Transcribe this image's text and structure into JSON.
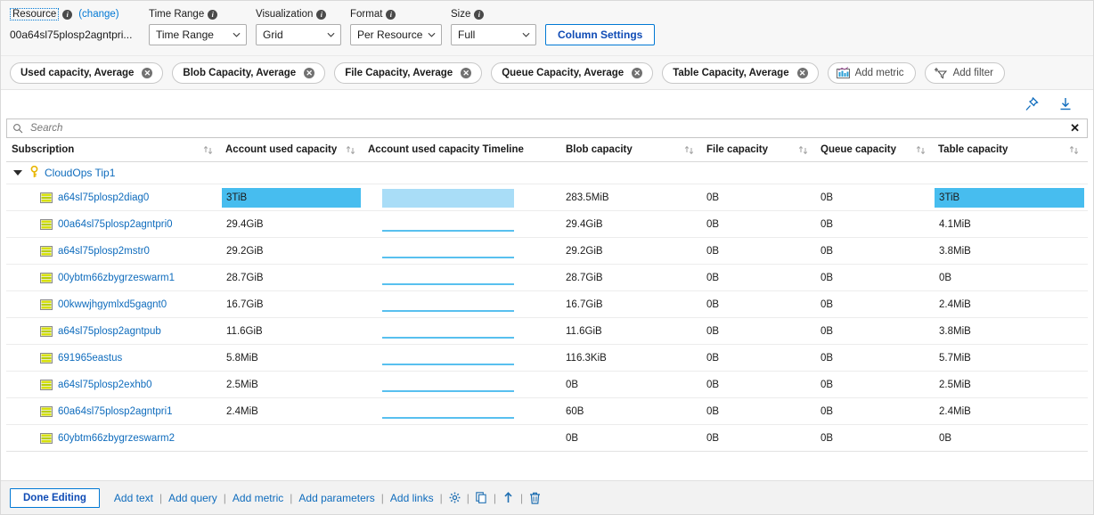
{
  "params": {
    "resource": {
      "label": "Resource",
      "change_link": "(change)",
      "value": "00a64sl75plosp2agntpri..."
    },
    "time_range": {
      "label": "Time Range",
      "value": "Time Range"
    },
    "visualization": {
      "label": "Visualization",
      "value": "Grid"
    },
    "format": {
      "label": "Format",
      "value": "Per Resource"
    },
    "size": {
      "label": "Size",
      "value": "Full"
    },
    "column_settings_label": "Column Settings"
  },
  "chips": [
    {
      "label": "Used capacity, Average",
      "icon": "close-circle-icon"
    },
    {
      "label": "Blob Capacity, Average",
      "icon": "close-circle-icon"
    },
    {
      "label": "File Capacity, Average",
      "icon": "close-circle-icon"
    },
    {
      "label": "Queue Capacity, Average",
      "icon": "close-circle-icon"
    },
    {
      "label": "Table Capacity, Average",
      "icon": "close-circle-icon"
    }
  ],
  "chip_actions": [
    {
      "label": "Add metric",
      "icon": "bar-chart-icon"
    },
    {
      "label": "Add filter",
      "icon": "add-filter-icon"
    }
  ],
  "strip": {
    "pin_icon": "pin-icon",
    "download_icon": "download-icon"
  },
  "search": {
    "placeholder": "Search",
    "value": "",
    "icon": "search-icon",
    "close": "✕"
  },
  "grid": {
    "columns": [
      {
        "key": "subscription",
        "label": "Subscription",
        "sortable": true
      },
      {
        "key": "account_used_capacity",
        "label": "Account used capacity",
        "sortable": true
      },
      {
        "key": "account_used_capacity_timeline",
        "label": "Account used capacity Timeline",
        "sortable": false
      },
      {
        "key": "blob_capacity",
        "label": "Blob capacity",
        "sortable": true
      },
      {
        "key": "file_capacity",
        "label": "File capacity",
        "sortable": true
      },
      {
        "key": "queue_capacity",
        "label": "Queue capacity",
        "sortable": true
      },
      {
        "key": "table_capacity",
        "label": "Table capacity",
        "sortable": true
      }
    ],
    "group": {
      "label": "CloudOps Tip1",
      "icon": "key-icon",
      "expanded": true
    },
    "rows": [
      {
        "name": "a64sl75plosp2diag0",
        "icon": "storage-account-icon",
        "account_used_capacity": "3TiB",
        "highlight": true,
        "timeline": "block",
        "blob_capacity": "283.5MiB",
        "file_capacity": "0B",
        "queue_capacity": "0B",
        "table_capacity": "3TiB",
        "table_highlight": true
      },
      {
        "name": "00a64sl75plosp2agntpri0",
        "icon": "storage-account-icon",
        "account_used_capacity": "29.4GiB",
        "highlight": false,
        "timeline": "line",
        "blob_capacity": "29.4GiB",
        "file_capacity": "0B",
        "queue_capacity": "0B",
        "table_capacity": "4.1MiB",
        "table_highlight": false
      },
      {
        "name": "a64sl75plosp2mstr0",
        "icon": "storage-account-icon",
        "account_used_capacity": "29.2GiB",
        "highlight": false,
        "timeline": "line",
        "blob_capacity": "29.2GiB",
        "file_capacity": "0B",
        "queue_capacity": "0B",
        "table_capacity": "3.8MiB",
        "table_highlight": false
      },
      {
        "name": "00ybtm66zbygrzeswarm1",
        "icon": "storage-account-icon",
        "account_used_capacity": "28.7GiB",
        "highlight": false,
        "timeline": "line",
        "blob_capacity": "28.7GiB",
        "file_capacity": "0B",
        "queue_capacity": "0B",
        "table_capacity": "0B",
        "table_highlight": false
      },
      {
        "name": "00kwwjhgymlxd5gagnt0",
        "icon": "storage-account-icon",
        "account_used_capacity": "16.7GiB",
        "highlight": false,
        "timeline": "line",
        "blob_capacity": "16.7GiB",
        "file_capacity": "0B",
        "queue_capacity": "0B",
        "table_capacity": "2.4MiB",
        "table_highlight": false
      },
      {
        "name": "a64sl75plosp2agntpub",
        "icon": "storage-account-icon",
        "account_used_capacity": "11.6GiB",
        "highlight": false,
        "timeline": "line",
        "blob_capacity": "11.6GiB",
        "file_capacity": "0B",
        "queue_capacity": "0B",
        "table_capacity": "3.8MiB",
        "table_highlight": false
      },
      {
        "name": "691965eastus",
        "icon": "storage-account-icon",
        "account_used_capacity": "5.8MiB",
        "highlight": false,
        "timeline": "line",
        "blob_capacity": "116.3KiB",
        "file_capacity": "0B",
        "queue_capacity": "0B",
        "table_capacity": "5.7MiB",
        "table_highlight": false
      },
      {
        "name": "a64sl75plosp2exhb0",
        "icon": "storage-account-icon",
        "account_used_capacity": "2.5MiB",
        "highlight": false,
        "timeline": "line",
        "blob_capacity": "0B",
        "file_capacity": "0B",
        "queue_capacity": "0B",
        "table_capacity": "2.5MiB",
        "table_highlight": false
      },
      {
        "name": "60a64sl75plosp2agntpri1",
        "icon": "storage-account-icon",
        "account_used_capacity": "2.4MiB",
        "highlight": false,
        "timeline": "line",
        "blob_capacity": "60B",
        "file_capacity": "0B",
        "queue_capacity": "0B",
        "table_capacity": "2.4MiB",
        "table_highlight": false
      },
      {
        "name": "60ybtm66zbygrzeswarm2",
        "icon": "storage-account-icon",
        "account_used_capacity": "",
        "highlight": false,
        "timeline": "none",
        "blob_capacity": "0B",
        "file_capacity": "0B",
        "queue_capacity": "0B",
        "table_capacity": "0B",
        "table_highlight": false
      }
    ]
  },
  "footer": {
    "done_label": "Done Editing",
    "links": [
      "Add text",
      "Add query",
      "Add metric",
      "Add parameters",
      "Add links"
    ],
    "separator": "|",
    "icons": [
      {
        "name": "gear-icon"
      },
      {
        "name": "copy-icon"
      },
      {
        "name": "move-up-icon"
      },
      {
        "name": "delete-icon"
      }
    ]
  },
  "colors": {
    "accent": "#0078d4",
    "link": "#0f6cbd",
    "highlight_bar": "#47bdef",
    "spark_block": "#a9ddf7",
    "spark_line": "#58c0ef"
  }
}
